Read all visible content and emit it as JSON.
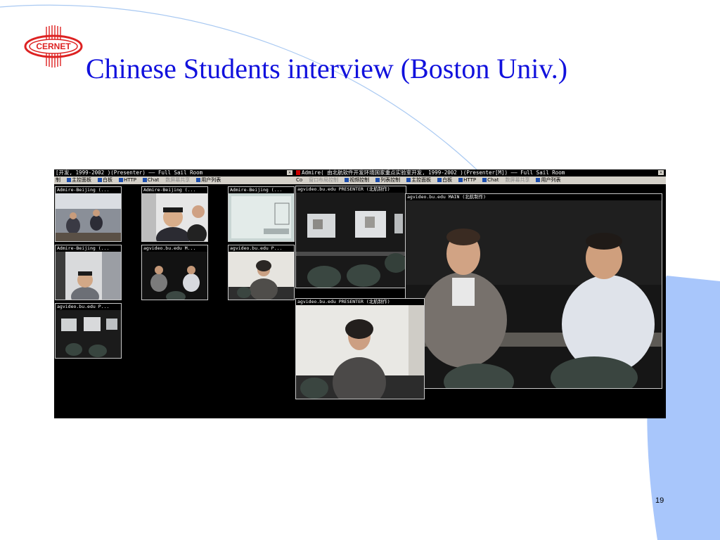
{
  "slide": {
    "title": "Chinese Students interview (Boston Univ.)",
    "page_number": "19",
    "logo_text": "CERNET",
    "colors": {
      "title": "#1111dd",
      "arc": "#a9c9f2",
      "accent_band": "#a8c6fb"
    }
  },
  "left_window": {
    "title": "[开发, 1999-2002 )(Presenter) —— Full Sail Room",
    "menu": [
      {
        "label": "制",
        "disabled": false
      },
      {
        "label": "主控面板",
        "disabled": false
      },
      {
        "label": "白板",
        "disabled": false
      },
      {
        "label": "HTTP",
        "disabled": false
      },
      {
        "label": "Chat",
        "disabled": false
      },
      {
        "label": "数屏幕共享",
        "disabled": true
      },
      {
        "label": "用户列表",
        "disabled": false
      }
    ],
    "videos": [
      {
        "caption": "Admire-Beijing (..."
      },
      {
        "caption": "Admire-Beijing (..."
      },
      {
        "caption": "Admire-Beijing (..."
      },
      {
        "caption": "Admire-Beijing (..."
      },
      {
        "caption": "agvideo.bu.edu M..."
      },
      {
        "caption": "agvideo.bu.edu P..."
      },
      {
        "caption": "agvideo.bu.edu P..."
      }
    ]
  },
  "right_window": {
    "title": "Admire( 由北航软件开发环境国家重点实验室开发, 1999-2002 )(Presenter[M]) —— Full Sail Room",
    "menu": [
      {
        "label": "Co",
        "disabled": false
      },
      {
        "label": "窗口布局控制",
        "disabled": true
      },
      {
        "label": "视频控制",
        "disabled": false
      },
      {
        "label": "列表控制",
        "disabled": false
      },
      {
        "label": "主控面板",
        "disabled": false
      },
      {
        "label": "白板",
        "disabled": false
      },
      {
        "label": "HTTP",
        "disabled": false
      },
      {
        "label": "Chat",
        "disabled": false
      },
      {
        "label": "数屏幕共享",
        "disabled": true
      },
      {
        "label": "用户列表",
        "disabled": false
      }
    ],
    "videos": [
      {
        "caption": "agvideo.bu.edu PRESENTER (北航制作)"
      },
      {
        "caption": "agvideo.bu.edu MAIN (北航制作)"
      },
      {
        "caption": "agvideo.bu.edu PRESENTER (北航制作)"
      }
    ]
  }
}
